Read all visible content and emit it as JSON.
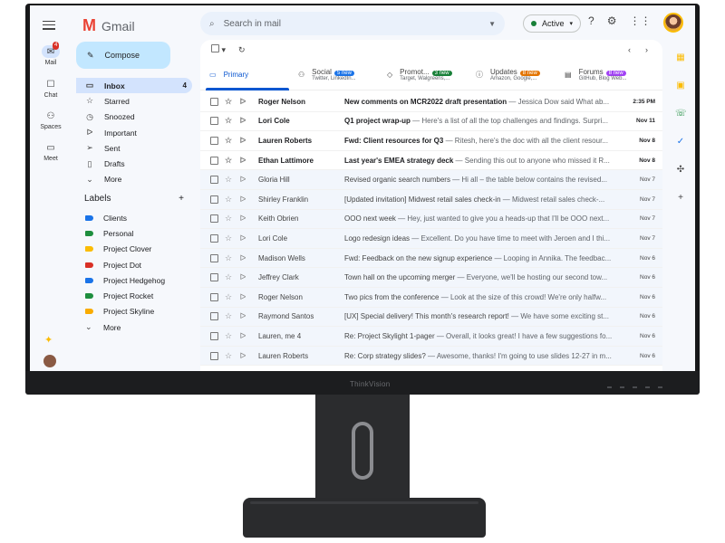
{
  "monitor": {
    "brand": "ThinkVision"
  },
  "app": {
    "name": "Gmail",
    "logo_letter": "M"
  },
  "rail": {
    "items": [
      {
        "label": "Mail",
        "icon": "mail-icon",
        "badge": "4"
      },
      {
        "label": "Chat",
        "icon": "chat-icon"
      },
      {
        "label": "Spaces",
        "icon": "spaces-icon"
      },
      {
        "label": "Meet",
        "icon": "meet-icon"
      }
    ]
  },
  "search": {
    "placeholder": "Search in mail"
  },
  "status": {
    "label": "Active"
  },
  "compose": {
    "label": "Compose"
  },
  "nav": [
    {
      "label": "Inbox",
      "icon": "inbox-icon",
      "count": "4"
    },
    {
      "label": "Starred",
      "icon": "star-icon"
    },
    {
      "label": "Snoozed",
      "icon": "clock-icon"
    },
    {
      "label": "Important",
      "icon": "important-icon"
    },
    {
      "label": "Sent",
      "icon": "send-icon"
    },
    {
      "label": "Drafts",
      "icon": "draft-icon"
    },
    {
      "label": "More",
      "icon": "chevron-down-icon"
    }
  ],
  "labels": {
    "heading": "Labels",
    "items": [
      {
        "label": "Clients",
        "color": "#1a73e8"
      },
      {
        "label": "Personal",
        "color": "#1e8e3e"
      },
      {
        "label": "Project Clover",
        "color": "#fbbc04"
      },
      {
        "label": "Project Dot",
        "color": "#d93025"
      },
      {
        "label": "Project Hedgehog",
        "color": "#1a73e8"
      },
      {
        "label": "Project Rocket",
        "color": "#1e8e3e"
      },
      {
        "label": "Project Skyline",
        "color": "#f9ab00"
      }
    ],
    "more": "More"
  },
  "tabs": [
    {
      "label": "Primary",
      "sub": "",
      "pill": "",
      "pill_color": ""
    },
    {
      "label": "Social",
      "sub": "Twitter, LinkedIn...",
      "pill": "5 new",
      "pill_color": "#1a73e8"
    },
    {
      "label": "Promot...",
      "sub": "Target, Walgreens,...",
      "pill": "3 new",
      "pill_color": "#188038"
    },
    {
      "label": "Updates",
      "sub": "Amazon, Google,...",
      "pill": "8 new",
      "pill_color": "#e37400"
    },
    {
      "label": "Forums",
      "sub": "GitHub, Blog Web...",
      "pill": "8 new",
      "pill_color": "#a142f4"
    }
  ],
  "emails": [
    {
      "sender": "Roger Nelson",
      "subject": "New comments on MCR2022 draft presentation",
      "snippet": " — Jessica Dow said What ab...",
      "date": "2:35 PM",
      "unread": true
    },
    {
      "sender": "Lori Cole",
      "subject": "Q1 project wrap-up",
      "snippet": " — Here's a list of all the top challenges and findings. Surpri...",
      "date": "Nov 11",
      "unread": true
    },
    {
      "sender": "Lauren Roberts",
      "subject": "Fwd: Client resources for Q3",
      "snippet": " — Ritesh, here's the doc with all the client resour...",
      "date": "Nov 8",
      "unread": true
    },
    {
      "sender": "Ethan Lattimore",
      "subject": "Last year's EMEA strategy deck",
      "snippet": " — Sending this out to anyone who missed it R...",
      "date": "Nov 8",
      "unread": true
    },
    {
      "sender": "Gloria Hill",
      "subject": "Revised organic search numbers",
      "snippet": " — Hi all – the table below contains the revised...",
      "date": "Nov 7",
      "unread": false
    },
    {
      "sender": "Shirley Franklin",
      "subject": "[Updated invitation] Midwest retail sales check-in",
      "snippet": " — Midwest retail sales check-...",
      "date": "Nov 7",
      "unread": false
    },
    {
      "sender": "Keith Obrien",
      "subject": "OOO next week",
      "snippet": " — Hey, just wanted to give you a heads-up that I'll be OOO next...",
      "date": "Nov 7",
      "unread": false
    },
    {
      "sender": "Lori Cole",
      "subject": "Logo redesign ideas",
      "snippet": " — Excellent. Do you have time to meet with Jeroen and I thi...",
      "date": "Nov 7",
      "unread": false
    },
    {
      "sender": "Madison Wells",
      "subject": "Fwd: Feedback on the new signup experience",
      "snippet": " — Looping in Annika. The feedbac...",
      "date": "Nov 6",
      "unread": false
    },
    {
      "sender": "Jeffrey Clark",
      "subject": "Town hall on the upcoming merger",
      "snippet": " — Everyone, we'll be hosting our second tow...",
      "date": "Nov 6",
      "unread": false
    },
    {
      "sender": "Roger Nelson",
      "subject": "Two pics from the conference",
      "snippet": " — Look at the size of this crowd! We're only halfw...",
      "date": "Nov 6",
      "unread": false
    },
    {
      "sender": "Raymond Santos",
      "subject": "[UX] Special delivery! This month's research report!",
      "snippet": " — We have some exciting st...",
      "date": "Nov 6",
      "unread": false
    },
    {
      "sender": "Lauren, me  4",
      "subject": "Re: Project Skylight 1-pager",
      "snippet": " — Overall, it looks great! I have a few suggestions fo...",
      "date": "Nov 6",
      "unread": false
    },
    {
      "sender": "Lauren Roberts",
      "subject": "Re: Corp strategy slides?",
      "snippet": " — Awesome, thanks! I'm going to use slides 12-27 in m...",
      "date": "Nov 6",
      "unread": false
    }
  ]
}
